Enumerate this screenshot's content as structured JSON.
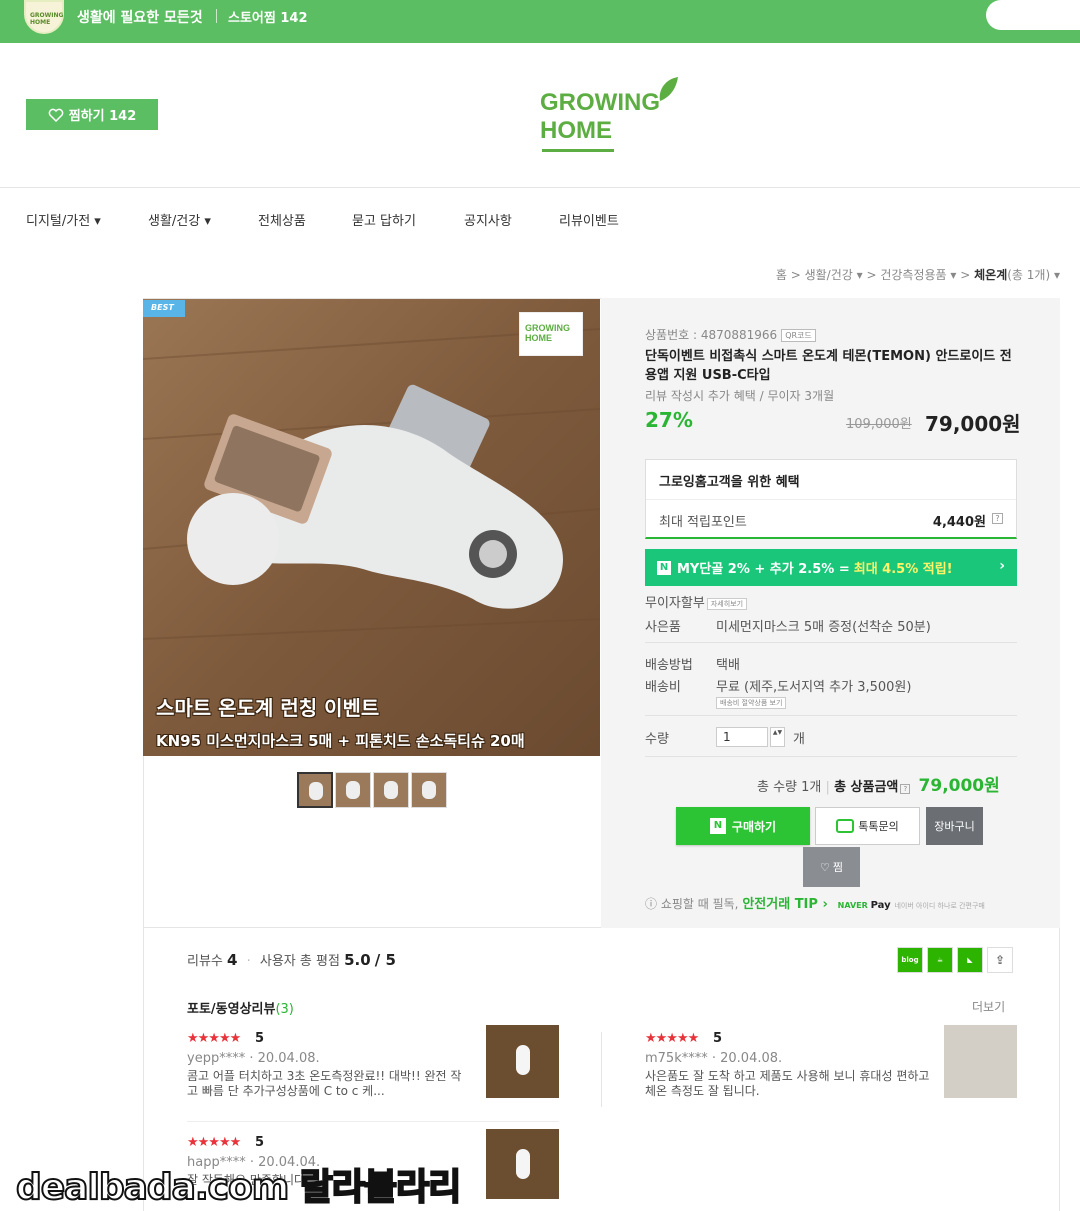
{
  "topbar": {
    "logo_text": "GROWING HOME",
    "tagline": "생활에 필요한 모든것",
    "store_fav": "스토어찜 142"
  },
  "header": {
    "zzim_label": "찜하기 142",
    "brand_line1": "GROWING",
    "brand_line2": "HOME"
  },
  "nav": [
    {
      "label": "디지털/가전 ▾"
    },
    {
      "label": "생활/건강 ▾"
    },
    {
      "label": "전체상품"
    },
    {
      "label": "묻고 답하기"
    },
    {
      "label": "공지사항"
    },
    {
      "label": "리뷰이벤트"
    }
  ],
  "breadcrumb": {
    "home": "홈",
    "l1": "생활/건강",
    "l2": "건강측정용품",
    "current": "체온계",
    "count": "(총 1개)"
  },
  "product": {
    "badge": "BEST",
    "image_brand": "GROWING HOME",
    "image_title": "스마트 온도계 런칭 이벤트",
    "image_subtitle": "KN95 미스먼지마스크 5매 + 피톤치드 손소독티슈 20매",
    "number_label": "상품번호 : 4870881966",
    "qr_label": "QR코드",
    "title": "단독이벤트 비접촉식 스마트 온도계 테몬(TEMON) 안드로이드 전용앱 지원 USB-C타입",
    "subtitle": "리뷰 작성시 추가 혜택 / 무이자 3개월",
    "discount": "27%",
    "original_price": "109,000원",
    "price": "79,000원"
  },
  "benefit": {
    "title": "그로잉홈고객을 위한 혜택",
    "points_label": "최대 적립포인트",
    "points_value": "4,440원",
    "help": "?"
  },
  "npay_banner": {
    "badge": "N",
    "text": "MY단골 2% + 추가 2.5% =",
    "highlight": "최대 4.5% 적립!",
    "chevron": "›"
  },
  "info": {
    "installment_label": "무이자할부",
    "installment_btn": "자세히보기",
    "gift_label": "사은품",
    "gift_value": "미세먼지마스크 5매 증정(선착순 50분)",
    "ship_method_label": "배송방법",
    "ship_method_value": "택배",
    "ship_fee_label": "배송비",
    "ship_fee_value": "무료 (제주,도서지역 추가 3,500원)",
    "ship_fee_btn": "배송비 절약상품 보기",
    "qty_label": "수량",
    "qty_value": "1",
    "qty_unit": "개",
    "step": "▲▼"
  },
  "total": {
    "qty_text": "총 수량 1개",
    "sep": "|",
    "amount_label": "총 상품금액",
    "help": "?",
    "amount": "79,000원"
  },
  "buttons": {
    "buy_badge": "N",
    "buy": "구매하기",
    "talk": "톡톡문의",
    "cart": "장바구니",
    "zzim": "찜"
  },
  "safe_tip": {
    "prefix": "ⓘ 쇼핑할 때 필독,",
    "highlight": "안전거래 TIP ›",
    "naver": "NAVER",
    "pay": "Pay",
    "tiny": "네이버 아이디 하나로 간편구매"
  },
  "reviews": {
    "count_label": "리뷰수",
    "count": "4",
    "rating_label": "사용자 총 평점",
    "rating": "5.0",
    "rating_max": "/ 5",
    "share_icons": [
      "blog",
      "cafe",
      "band",
      "share"
    ],
    "photo_title": "포토/동영상리뷰",
    "photo_count": "(3)",
    "more": "더보기",
    "items": [
      {
        "stars": "★★★★★",
        "score": "5",
        "meta": "yepp**** · 20.04.08.",
        "text": "콤고 어플 터치하고 3초 온도측정완료!! 대박!! 완전 작고 빠름 단 추가구성상품에 C to c 케..."
      },
      {
        "stars": "★★★★★",
        "score": "5",
        "meta": "m75k**** · 20.04.08.",
        "text": "사은품도 잘 도착 하고 제품도 사용해 보니 휴대성 편하고 체온 측정도 잘 됩니다."
      },
      {
        "stars": "★★★★★",
        "score": "5",
        "meta": "happ**** · 20.04.04.",
        "text": "잘 작동해요 만족합니다"
      }
    ]
  },
  "watermark": "dealbada.com 랄라블라리",
  "colors": {
    "brand_green": "#5cbe62",
    "accent_green": "#2bb534",
    "npay_green": "#1ac77a",
    "star_red": "#e8333a"
  }
}
